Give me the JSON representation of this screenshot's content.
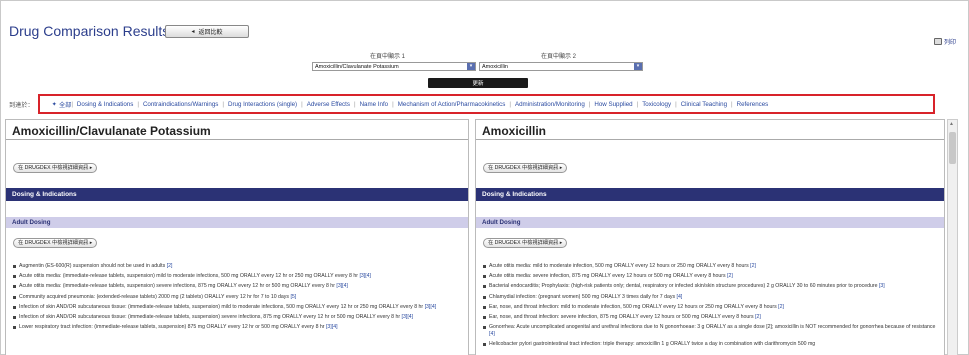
{
  "page": {
    "title": "Drug Comparison Results",
    "back_label": "返回比較",
    "print_label": "列印"
  },
  "selectors": {
    "label1": "在頁中顯示 1",
    "label2": "在頁中顯示 2",
    "value1": "Amoxicillin/Clavulanate Potassium",
    "value2": "Amoxicillin",
    "go_label": "更新"
  },
  "nav": {
    "label": "到達於：",
    "first": "全部",
    "items": [
      "Dosing & Indications",
      "Contraindications/Warnings",
      "Drug Interactions (single)",
      "Adverse Effects",
      "Name Info",
      "Mechanism of Action/Pharmacokinetics",
      "Administration/Monitoring",
      "How Supplied",
      "Toxicology",
      "Clinical Teaching",
      "References"
    ]
  },
  "left": {
    "drug": "Amoxicillin/Clavulanate Potassium",
    "detail_btn": "在 DRUGDEX 中檢視詳細資訊 ▸",
    "section": "Dosing & Indications",
    "subsection": "Adult Dosing",
    "detail_btn2": "在 DRUGDEX 中檢視詳細資訊 ▸",
    "bullets": [
      {
        "text": "Augmentin (ES-600(R) suspension should not be used in adults",
        "ref": "[2]"
      },
      {
        "text": "Acute otitis media: (immediate-release tablets, suspension) mild to moderate infections, 500 mg ORALLY every 12 hr or 250 mg ORALLY every 8 hr",
        "ref": "[3][4]"
      },
      {
        "text": "Acute otitis media: (immediate-release tablets, suspension) severe infections, 875 mg ORALLY every 12 hr or 500 mg ORALLY every 8 hr",
        "ref": "[3][4]"
      },
      {
        "text": "Community acquired pneumonia: (extended-release tablets) 2000 mg (2 tablets) ORALLY every 12 hr for 7 to 10 days",
        "ref": "[5]"
      },
      {
        "text": "Infection of skin AND/OR subcutaneous tissue: (immediate-release tablets, suspension) mild to moderate infections, 500 mg ORALLY every 12 hr or 250 mg ORALLY every 8 hr",
        "ref": "[3][4]"
      },
      {
        "text": "Infection of skin AND/OR subcutaneous tissue: (immediate-release tablets, suspension) severe infections, 875 mg ORALLY every 12 hr or 500 mg ORALLY every 8 hr",
        "ref": "[3][4]"
      },
      {
        "text": "Lower respiratory tract infection: (immediate-release tablets, suspension) 875 mg ORALLY every 12 hr or 500 mg ORALLY every 8 hr",
        "ref": "[3][4]"
      }
    ]
  },
  "right": {
    "drug": "Amoxicillin",
    "detail_btn": "在 DRUGDEX 中檢視詳細資訊 ▸",
    "section": "Dosing & Indications",
    "subsection": "Adult Dosing",
    "detail_btn2": "在 DRUGDEX 中檢視詳細資訊 ▸",
    "bullets": [
      {
        "text": "Acute otitis media: mild to moderate infection, 500 mg ORALLY every 12 hours or 250 mg ORALLY every 8 hours",
        "ref": "[2]"
      },
      {
        "text": "Acute otitis media: severe infection, 875 mg ORALLY every 12 hours or 500 mg ORALLY every 8 hours",
        "ref": "[2]"
      },
      {
        "text": "Bacterial endocarditis; Prophylaxis: (high-risk patients only; dental, respiratory or infected skin/skin structure procedures) 2 g ORALLY 30 to 60 minutes prior to procedure",
        "ref": "[3]"
      },
      {
        "text": "Chlamydial infection: (pregnant women) 500 mg ORALLY 3 times daily for 7 days",
        "ref": "[4]"
      },
      {
        "text": "Ear, nose, and throat infection: mild to moderate infection, 500 mg ORALLY every 12 hours or 250 mg ORALLY every 8 hours",
        "ref": "[2]"
      },
      {
        "text": "Ear, nose, and throat infection: severe infection, 875 mg ORALLY every 12 hours or 500 mg ORALLY every 8 hours",
        "ref": "[2]"
      },
      {
        "text": "Gonorrhea: Acute uncomplicated anogenital and urethral infections due to N gonorrhoeae: 3 g ORALLY as a single dose [2]; amoxicillin is NOT recommended for gonorrhea because of resistance",
        "ref": "[4]"
      },
      {
        "text": "Helicobacter pylori gastrointestinal tract infection: triple therapy: amoxicillin 1 g ORALLY twice a day in combination with clarithromycin 500 mg",
        "ref": ""
      }
    ]
  }
}
